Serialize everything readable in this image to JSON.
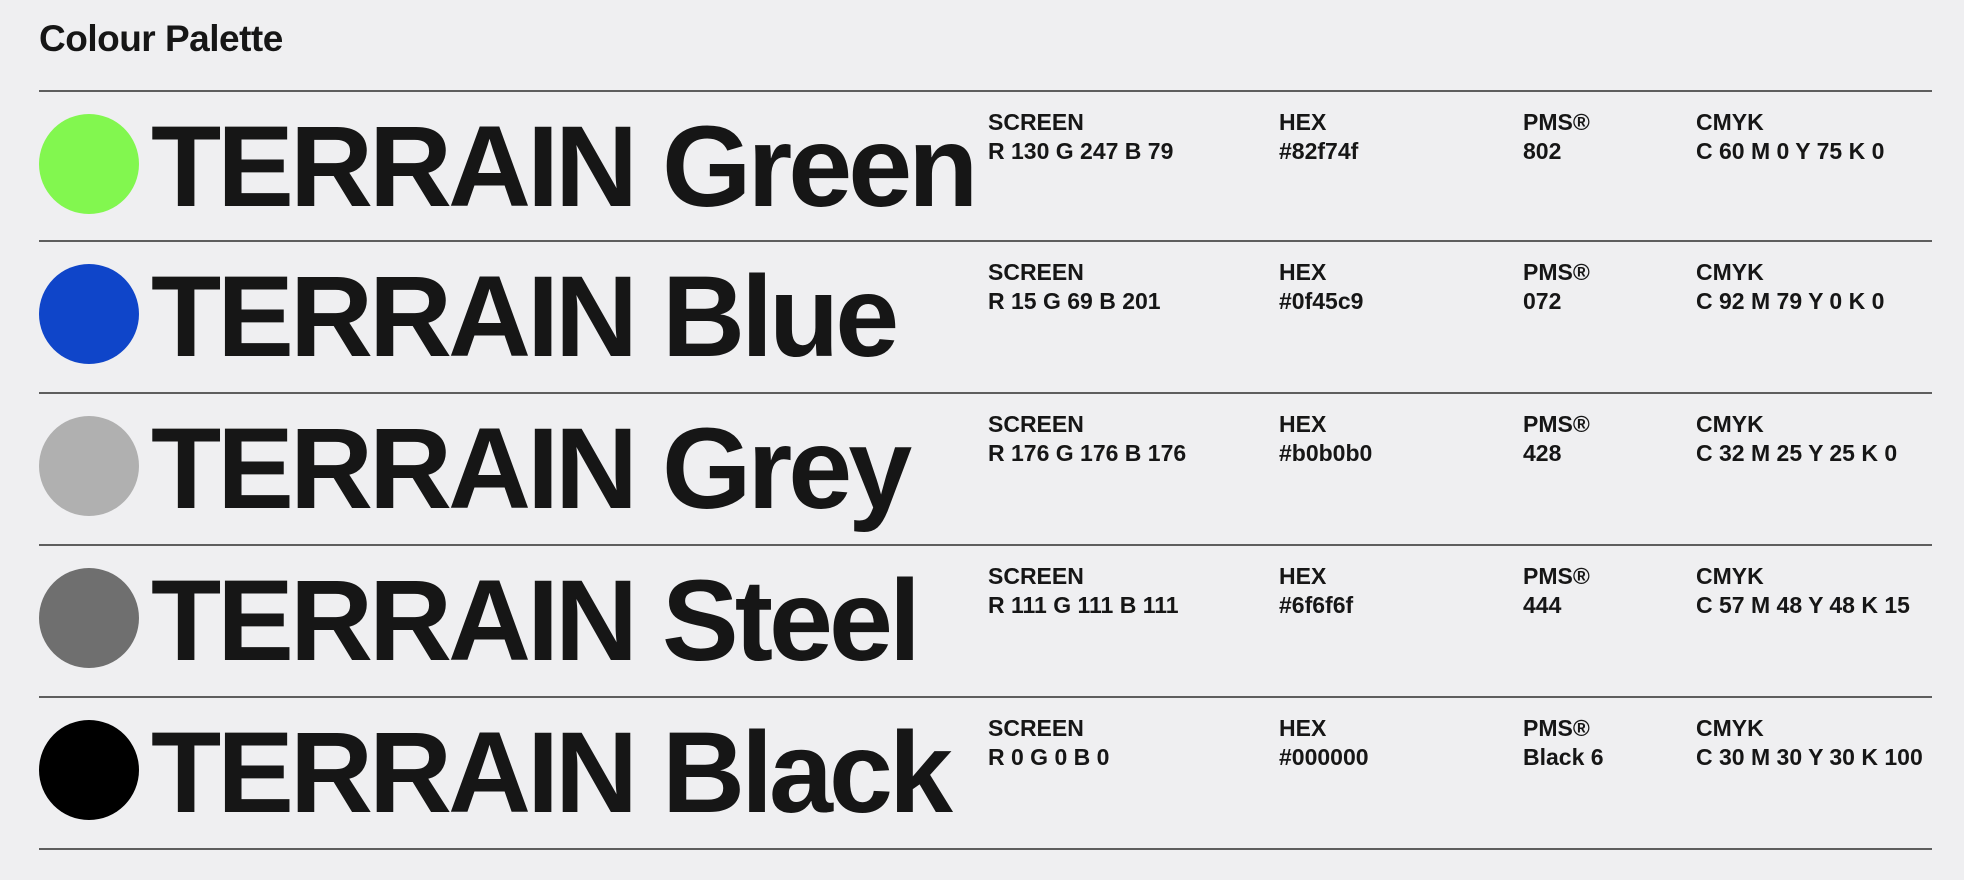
{
  "title": "Colour Palette",
  "labels": {
    "screen": "SCREEN",
    "hex": "HEX",
    "pms": "PMS®",
    "cmyk": "CMYK"
  },
  "colors": [
    {
      "name": "TERRAIN Green",
      "swatch": "#82f74f",
      "screen": "R 130 G 247 B 79",
      "hex": "#82f74f",
      "pms": "802",
      "cmyk": "C 60 M 0 Y 75 K 0"
    },
    {
      "name": "TERRAIN Blue",
      "swatch": "#0f45c9",
      "screen": "R 15 G 69 B 201",
      "hex": "#0f45c9",
      "pms": "072",
      "cmyk": "C 92 M 79 Y 0 K 0"
    },
    {
      "name": "TERRAIN Grey",
      "swatch": "#b0b0b0",
      "screen": "R 176 G 176 B 176",
      "hex": "#b0b0b0",
      "pms": "428",
      "cmyk": "C 32 M 25 Y 25 K 0"
    },
    {
      "name": "TERRAIN Steel",
      "swatch": "#6f6f6f",
      "screen": "R 111 G 111 B 111",
      "hex": "#6f6f6f",
      "pms": "444",
      "cmyk": "C 57 M 48 Y 48 K 15"
    },
    {
      "name": "TERRAIN Black",
      "swatch": "#000000",
      "screen": "R 0 G 0 B 0",
      "hex": "#000000",
      "pms": "Black 6",
      "cmyk": "C 30 M 30 Y 30 K 100"
    }
  ]
}
